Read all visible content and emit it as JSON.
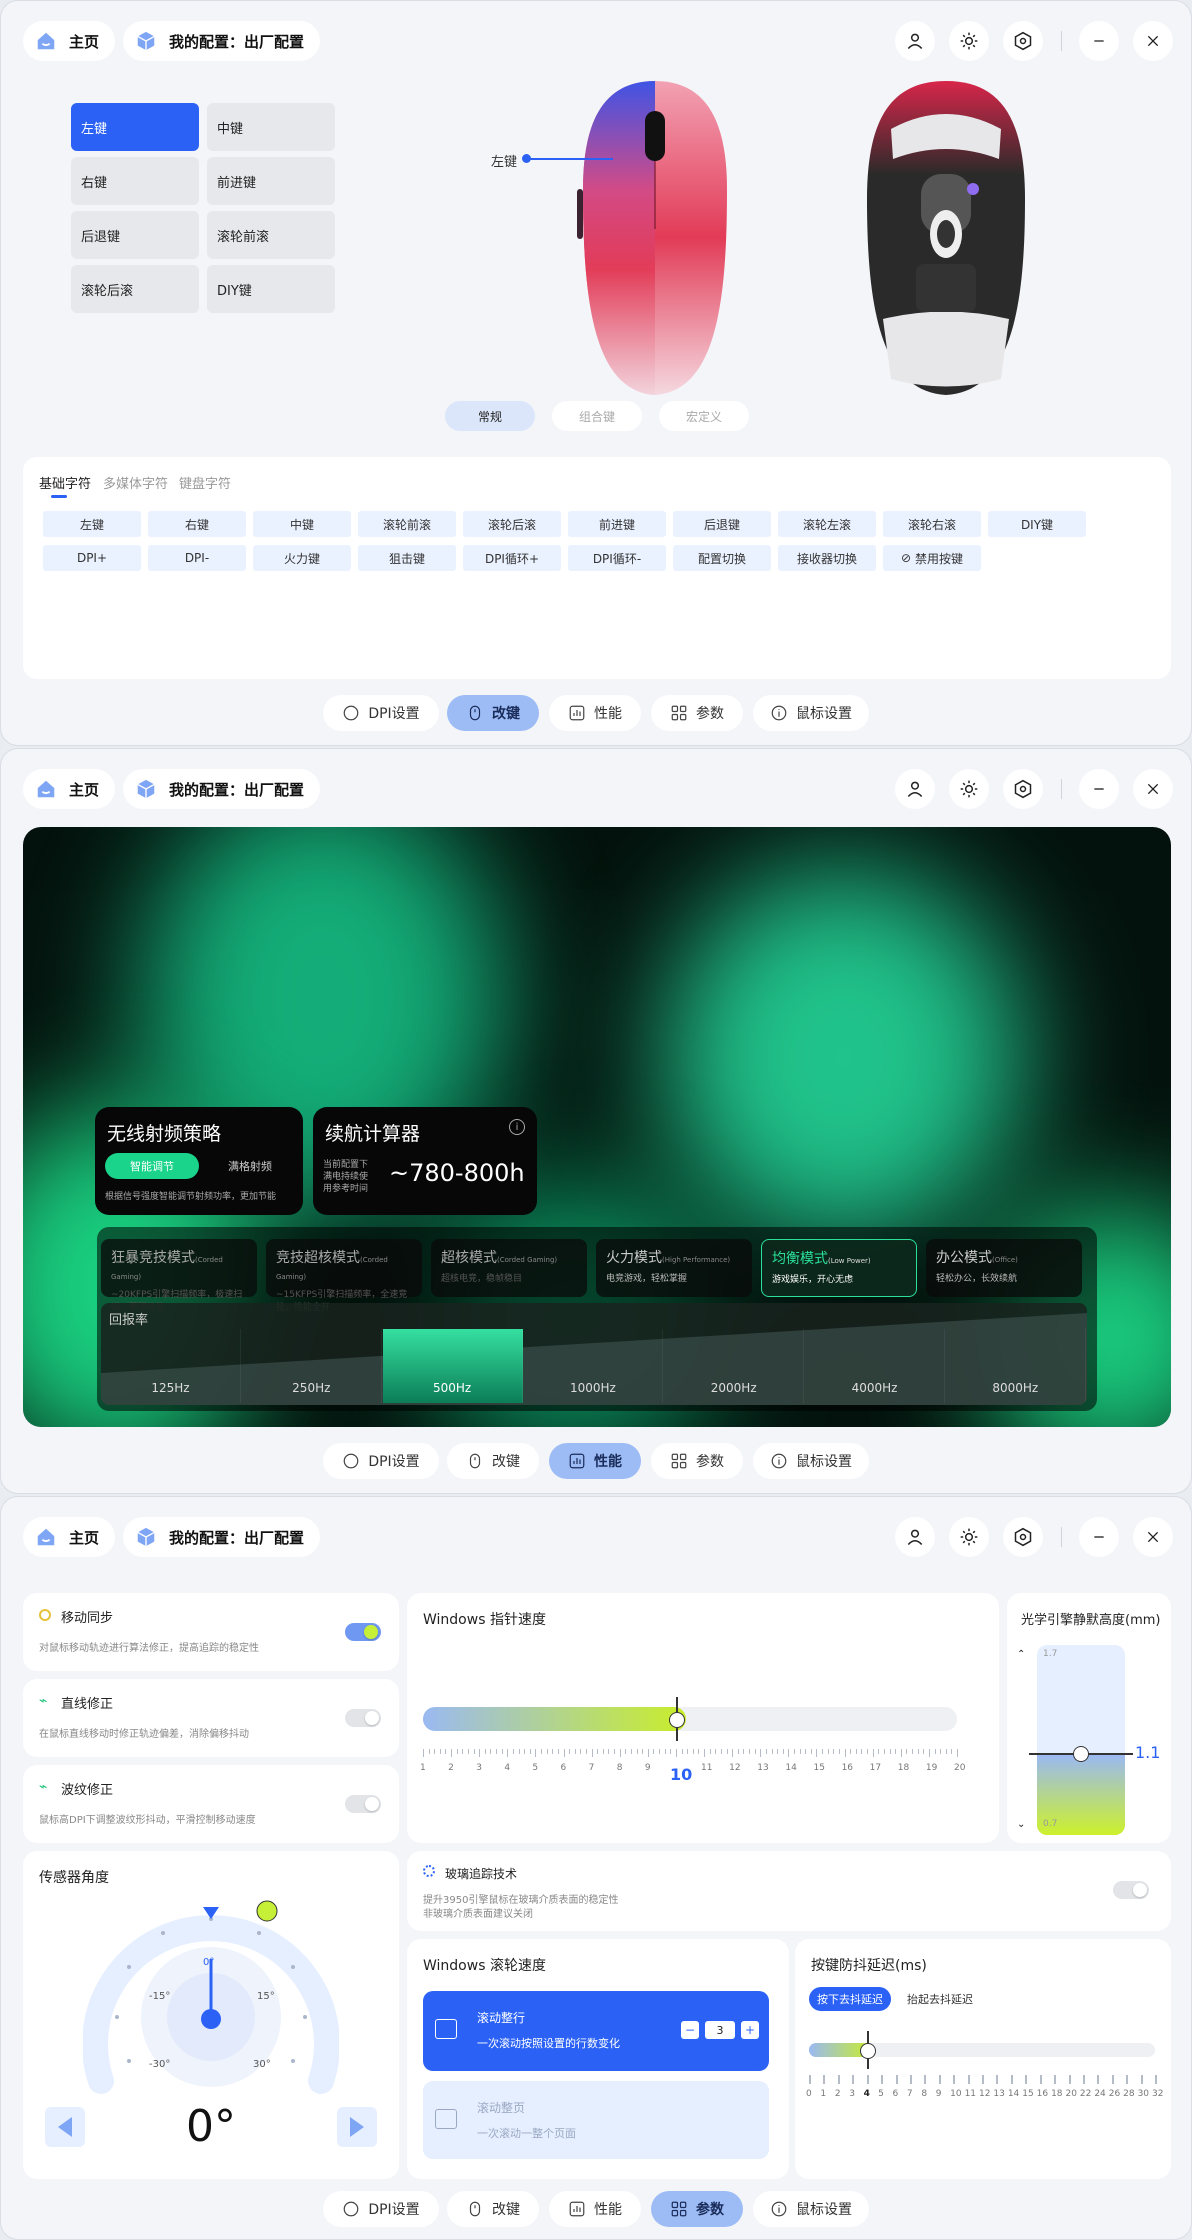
{
  "window": {
    "home_label": "主页",
    "config_label": "我的配置：出厂配置"
  },
  "bottom_nav": [
    {
      "label": "DPI设置",
      "icon": "gauge-icon"
    },
    {
      "label": "改键",
      "icon": "mouse-icon"
    },
    {
      "label": "性能",
      "icon": "chart-icon"
    },
    {
      "label": "参数",
      "icon": "grid-icon"
    },
    {
      "label": "鼠标设置",
      "icon": "info-icon"
    }
  ],
  "keymap": {
    "keys": [
      "左键",
      "中键",
      "右键",
      "前进键",
      "后退键",
      "滚轮前滚",
      "滚轮后滚",
      "DIY键"
    ],
    "selected": "左键",
    "callout": "左键",
    "mode_tabs": [
      "常规",
      "组合键",
      "宏定义"
    ],
    "char_tabs": [
      "基础字符",
      "多媒体字符",
      "键盘字符"
    ],
    "functions_row1": [
      "左键",
      "右键",
      "中键",
      "滚轮前滚",
      "滚轮后滚",
      "前进键",
      "后退键",
      "滚轮左滚",
      "滚轮右滚",
      "DIY键"
    ],
    "functions_row2": [
      "DPI+",
      "DPI-",
      "火力键",
      "狙击键",
      "DPI循环+",
      "DPI循环-",
      "配置切换",
      "接收器切换",
      "禁用按键"
    ]
  },
  "performance": {
    "rf_title": "无线射频策略",
    "rf_options": [
      "智能调节",
      "满格射频"
    ],
    "rf_desc": "根据信号强度智能调节射频功率，更加节能",
    "battery_title": "续航计算器",
    "battery_desc": [
      "当前配置下",
      "满电持续使",
      "用参考时间"
    ],
    "battery_value": "~780-800h",
    "modes": [
      {
        "name": "狂暴竞技模式",
        "en": "(Corded Gaming)",
        "desc": "~20KFPS引擎扫描频率，极速扫描，更强性能"
      },
      {
        "name": "竞技超核模式",
        "en": "(Corded Gaming)",
        "desc": "~15KFPS引擎扫描频率，全速竞技，性能全开"
      },
      {
        "name": "超核模式",
        "en": "(Corded Gaming)",
        "desc": "超核电竞，稳帧稳目"
      },
      {
        "name": "火力模式",
        "en": "(High Performance)",
        "desc": "电竞游戏，轻松掌握"
      },
      {
        "name": "均衡模式",
        "en": "(Low Power)",
        "desc": "游戏娱乐，开心无虑"
      },
      {
        "name": "办公模式",
        "en": "(Office)",
        "desc": "轻松办公，长效续航"
      }
    ],
    "selected_mode": "均衡模式",
    "polling_title": "回报率",
    "polling_rates": [
      "125Hz",
      "250Hz",
      "500Hz",
      "1000Hz",
      "2000Hz",
      "4000Hz",
      "8000Hz"
    ],
    "selected_rate": "500Hz"
  },
  "params": {
    "motion_sync": {
      "title": "移动同步",
      "desc": "对鼠标移动轨迹进行算法修正，提高追踪的稳定性",
      "on": true
    },
    "straight": {
      "title": "直线修正",
      "desc": "在鼠标直线移动时修正轨迹偏差，消除偏移抖动",
      "on": false
    },
    "ripple": {
      "title": "波纹修正",
      "desc": "鼠标高DPI下调整波纹形抖动，平滑控制移动速度",
      "on": false
    },
    "pointer": {
      "title": "Windows 指针速度",
      "value": "10",
      "value_num": 10,
      "min": 1,
      "max": 20,
      "ticks": [
        "1",
        "2",
        "3",
        "4",
        "5",
        "6",
        "7",
        "8",
        "9",
        "10",
        "11",
        "12",
        "13",
        "14",
        "15",
        "16",
        "17",
        "18",
        "19",
        "20"
      ]
    },
    "lod": {
      "title": "光学引擎静默高度(mm)",
      "top": "1.7",
      "bottom": "0.7",
      "value": "1.1",
      "value_num": 1.1
    },
    "sensor": {
      "title": "传感器角度",
      "value": "0°",
      "marks": [
        "0°",
        "-15°",
        "15°",
        "-30°",
        "30°"
      ]
    },
    "glass": {
      "title": "玻璃追踪技术",
      "desc1": "提升3950引擎鼠标在玻璃介质表面的稳定性",
      "desc2": "非玻璃介质表面建议关闭",
      "on": false
    },
    "scroll": {
      "title": "Windows 滚轮速度",
      "line_title": "滚动整行",
      "line_desc": "一次滚动按照设置的行数变化",
      "line_value": "3",
      "minus": "−",
      "plus": "+",
      "page_title": "滚动整页",
      "page_desc": "一次滚动一整个页面"
    },
    "debounce": {
      "title": "按键防抖延迟(ms)",
      "tabs": [
        "按下去抖延迟",
        "抬起去抖延迟"
      ],
      "value_num": 4,
      "ticks": [
        "0",
        "1",
        "2",
        "3",
        "4",
        "5",
        "6",
        "7",
        "8",
        "9",
        "10",
        "11",
        "12",
        "13",
        "14",
        "15",
        "16",
        "18",
        "20",
        "22",
        "24",
        "26",
        "28",
        "30",
        "32"
      ]
    }
  }
}
